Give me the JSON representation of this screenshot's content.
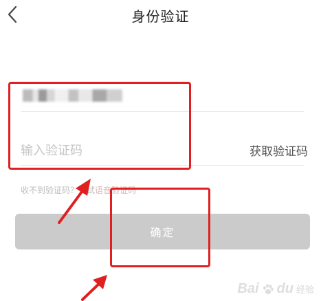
{
  "header": {
    "title": "身份验证",
    "back_icon": "chevron-left-icon"
  },
  "form": {
    "phone_value": "",
    "code_placeholder": "输入验证码",
    "get_code_label": "获取验证码",
    "hint_prefix": "收不到验证码？试试",
    "hint_link": "语音验证码"
  },
  "confirm_button": {
    "label": "确定"
  },
  "annotations": {
    "highlight_color": "#e02020"
  },
  "watermark": {
    "brand": "Bai",
    "brand_end": "du",
    "suffix": "经验"
  },
  "colors": {
    "button_disabled": "#cbcbcb",
    "placeholder": "#c4c4c4",
    "divider": "#e4e4e4"
  }
}
